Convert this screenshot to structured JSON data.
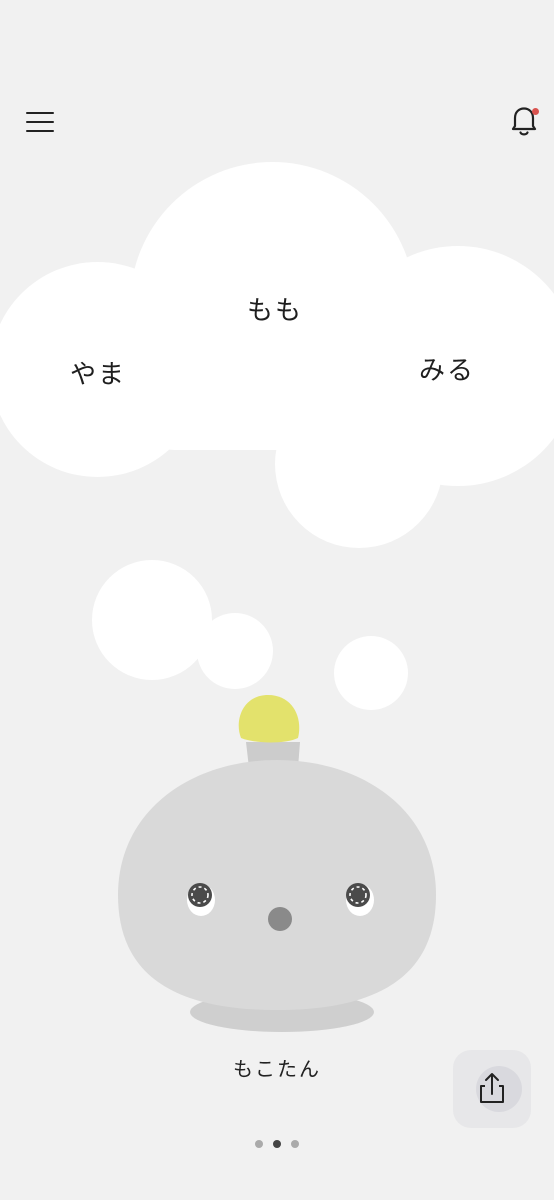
{
  "header": {
    "menu_icon": "hamburger-menu-icon",
    "notification_icon": "bell-icon",
    "notification_badge_color": "#d9534f"
  },
  "thought_cloud": {
    "words": [
      "もも",
      "やま",
      "みる"
    ]
  },
  "character": {
    "name": "もこたん",
    "body_color": "#d9d9d9",
    "antenna_color": "#e3e26c"
  },
  "share_button": {
    "icon": "share-icon"
  },
  "pagination": {
    "total": 3,
    "active_index": 1,
    "active_color": "#444444",
    "inactive_color": "#aaaaaa"
  }
}
